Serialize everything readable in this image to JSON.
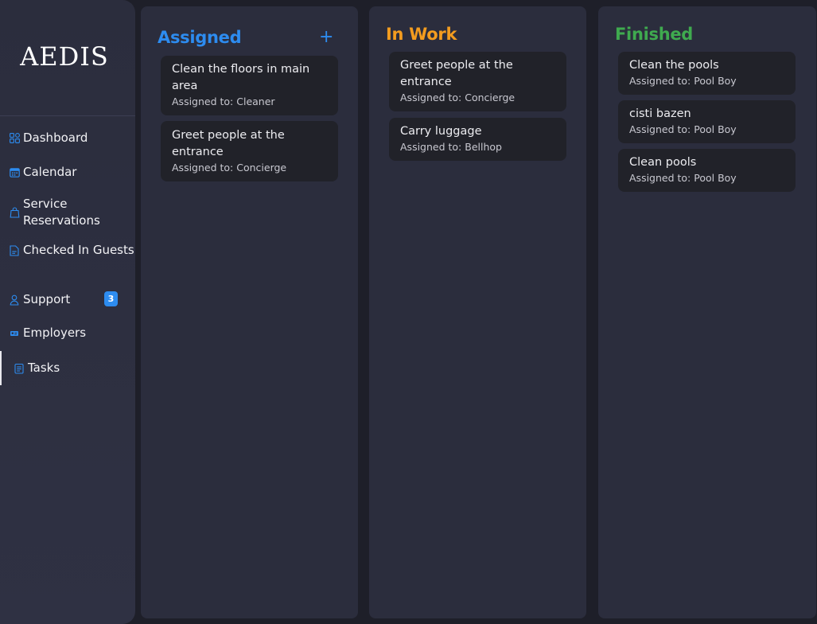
{
  "brand": {
    "logo_text": "AEDIS"
  },
  "sidebar": {
    "items": [
      {
        "label": "Dashboard",
        "icon": "grid-icon"
      },
      {
        "label": "Calendar",
        "icon": "calendar-icon"
      },
      {
        "label": "Service Reservations",
        "icon": "bag-icon"
      },
      {
        "label": "Checked In Guests",
        "icon": "document-icon"
      },
      {
        "label": "Support",
        "icon": "user-icon",
        "badge": "3"
      },
      {
        "label": "Employers",
        "icon": "id-card-icon"
      },
      {
        "label": "Tasks",
        "icon": "clipboard-icon",
        "active": true
      }
    ]
  },
  "board": {
    "columns": [
      {
        "title": "Assigned",
        "color": "#2d8cf0",
        "add_label": "+",
        "cards": [
          {
            "title": "Clean the floors in main area",
            "assignee": "Assigned to: Cleaner"
          },
          {
            "title": "Greet people at the entrance",
            "assignee": "Assigned to: Concierge"
          }
        ]
      },
      {
        "title": "In Work",
        "color": "#f39c1f",
        "cards": [
          {
            "title": "Greet people at the entrance",
            "assignee": "Assigned to: Concierge"
          },
          {
            "title": "Carry luggage",
            "assignee": "Assigned to: Bellhop"
          }
        ]
      },
      {
        "title": "Finished",
        "color": "#3faa4f",
        "cards": [
          {
            "title": "Clean the pools",
            "assignee": "Assigned to: Pool Boy"
          },
          {
            "title": "cisti bazen",
            "assignee": "Assigned to: Pool Boy"
          },
          {
            "title": "Clean pools",
            "assignee": "Assigned to: Pool Boy"
          }
        ]
      }
    ]
  },
  "colors": {
    "accent": "#2d8cf0",
    "background": "#1e1f29",
    "panel": "#2b2d3d",
    "card": "#212229"
  }
}
